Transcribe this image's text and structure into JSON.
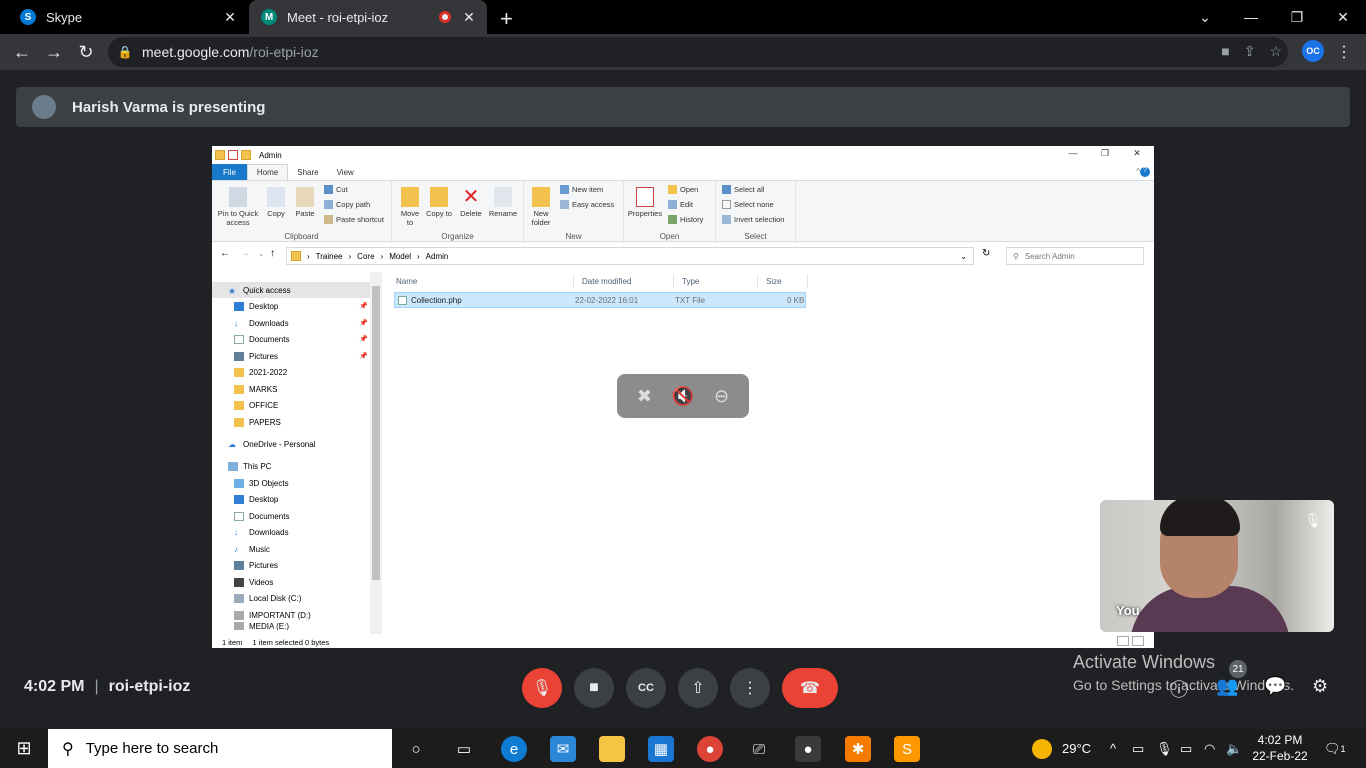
{
  "browser": {
    "tabs": [
      {
        "title": "Skype",
        "favicon_label": "S",
        "favicon_color": "#0078d4"
      },
      {
        "title": "Meet - roi-etpi-ioz",
        "favicon_label": "M",
        "favicon_color": "#00897b"
      }
    ],
    "url_host": "meet.google.com",
    "url_path": "/roi-etpi-ioz",
    "extension_label": "OC"
  },
  "meet": {
    "presenting_text": "Harish Varma is presenting",
    "time": "4:02 PM",
    "meeting_code": "roi-etpi-ioz",
    "self_label": "You",
    "participant_count": "21",
    "accent_red": "#ea4335"
  },
  "explorer": {
    "window_title": "Admin",
    "ribbon_tabs": [
      "File",
      "Home",
      "Share",
      "View"
    ],
    "clipboard": {
      "pin": "Pin to Quick access",
      "copy": "Copy",
      "paste": "Paste",
      "cut": "Cut",
      "copy_path": "Copy path",
      "paste_shortcut": "Paste shortcut",
      "label": "Clipboard"
    },
    "organize": {
      "move_to": "Move to",
      "copy_to": "Copy to",
      "delete": "Delete",
      "rename": "Rename",
      "label": "Organize"
    },
    "new": {
      "new_folder": "New folder",
      "new_item": "New item",
      "easy_access": "Easy access",
      "label": "New"
    },
    "open": {
      "properties": "Properties",
      "open": "Open",
      "edit": "Edit",
      "history": "History",
      "label": "Open"
    },
    "select": {
      "select_all": "Select all",
      "select_none": "Select none",
      "invert": "Invert selection",
      "label": "Select"
    },
    "breadcrumb": [
      "Trainee",
      "Core",
      "Model",
      "Admin"
    ],
    "search_placeholder": "Search Admin",
    "nav": {
      "quick_access": "Quick access",
      "quick_items": [
        "Desktop",
        "Downloads",
        "Documents",
        "Pictures",
        "2021-2022",
        "MARKS",
        "OFFICE",
        "PAPERS"
      ],
      "onedrive": "OneDrive - Personal",
      "this_pc": "This PC",
      "pc_items": [
        "3D Objects",
        "Desktop",
        "Documents",
        "Downloads",
        "Music",
        "Pictures",
        "Videos",
        "Local Disk (C:)",
        "IMPORTANT (D:)",
        "MEDIA (E:)"
      ]
    },
    "columns": [
      "Name",
      "Date modified",
      "Type",
      "Size"
    ],
    "files": [
      {
        "name": "Collection.php",
        "date": "22-02-2022 16:01",
        "type": "TXT File",
        "size": "0 KB"
      }
    ],
    "status": {
      "count": "1 item",
      "selected": "1 item selected  0 bytes"
    }
  },
  "watermark": {
    "line1": "Activate Windows",
    "line2": "Go to Settings to activate Windows."
  },
  "taskbar": {
    "search_placeholder": "Type here to search",
    "weather": "29°C",
    "time": "4:02 PM",
    "date": "22-Feb-22",
    "notifications": "1"
  }
}
